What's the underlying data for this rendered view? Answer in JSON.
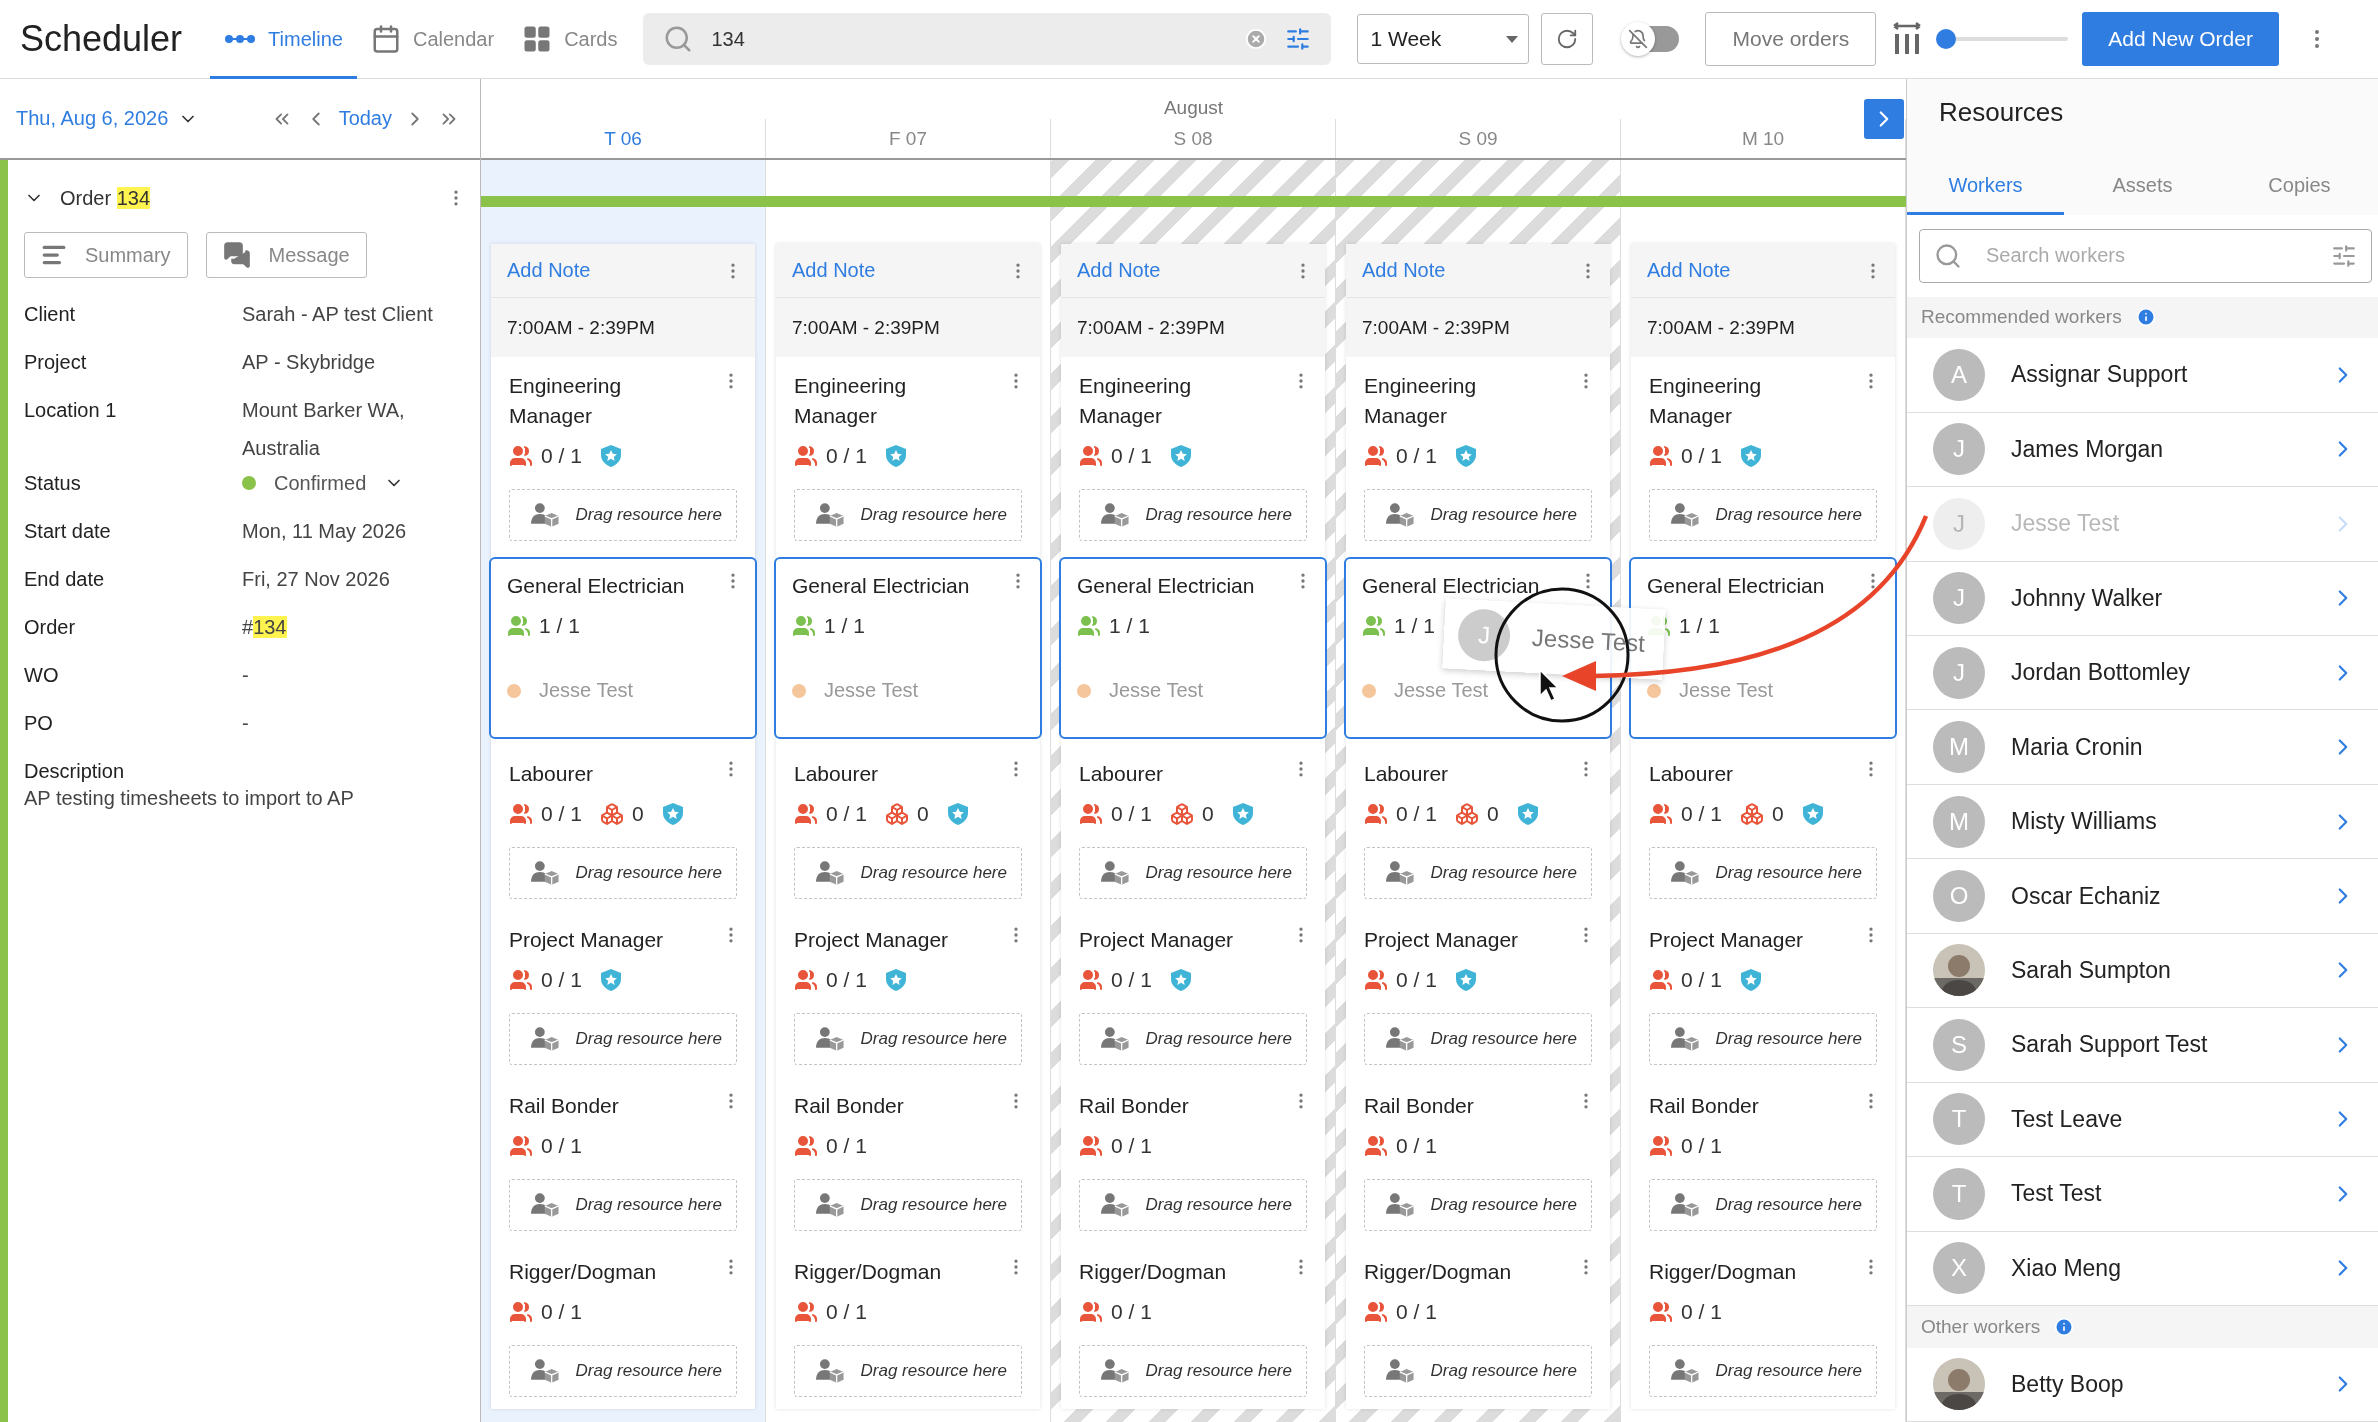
{
  "app": {
    "title": "Scheduler"
  },
  "views": [
    {
      "label": "Timeline",
      "kind": "timeline",
      "selected": true
    },
    {
      "label": "Calendar",
      "kind": "calendar",
      "selected": false
    },
    {
      "label": "Cards",
      "kind": "cards",
      "selected": false
    }
  ],
  "search": {
    "value": "134"
  },
  "range": {
    "value": "1 Week"
  },
  "notifications_toggle": {
    "on": false
  },
  "move_orders": "Move orders",
  "zoom_slider": {
    "level": 0
  },
  "add_button": "Add New Order",
  "date_nav": {
    "date": "Thu, Aug 6, 2026",
    "today": "Today"
  },
  "order": {
    "label": "Order",
    "match": "134",
    "expanded": true,
    "buttons": [
      {
        "label": "Summary",
        "kind": "summary"
      },
      {
        "label": "Message",
        "kind": "message"
      }
    ],
    "fields": [
      {
        "label": "Client",
        "kind": "text",
        "value": "Sarah - AP test Client"
      },
      {
        "label": "Project",
        "kind": "text",
        "value": "AP - Skybridge"
      },
      {
        "label": "Location 1",
        "kind": "text",
        "value": "Mount Barker WA, Australia"
      },
      {
        "label": "Status",
        "kind": "status",
        "value": "Confirmed",
        "color": "#8bc34a"
      },
      {
        "label": "Start date",
        "kind": "text",
        "value": "Mon, 11 May 2026"
      },
      {
        "label": "End date",
        "kind": "text",
        "value": "Fri, 27 Nov 2026"
      },
      {
        "label": "Order",
        "kind": "match",
        "prefix": "#",
        "value": "134"
      },
      {
        "label": "WO",
        "kind": "text",
        "value": "-"
      },
      {
        "label": "PO",
        "kind": "text",
        "value": "-"
      }
    ],
    "description": {
      "label": "Description",
      "text": "AP testing timesheets to import to AP"
    }
  },
  "timeline": {
    "month": "August",
    "days": [
      {
        "label": "T 06",
        "today": true,
        "weekend": false,
        "note_action": "Add Note",
        "shift": "7:00AM - 2:39PM",
        "roles": [
          {
            "title": "Engineering Manager",
            "count": "0 / 1",
            "full": false,
            "shield": true,
            "selected": false,
            "drop_hint": "Drag resource here"
          },
          {
            "title": "General Electrician",
            "count": "1 / 1",
            "full": true,
            "shield": false,
            "selected": true,
            "assigned": [
              {
                "name": "Jesse Test",
                "color": "#f5c59b"
              }
            ]
          },
          {
            "title": "Labourer",
            "count": "0 / 1",
            "full": false,
            "assets": "0",
            "shield": true,
            "selected": false,
            "drop_hint": "Drag resource here"
          },
          {
            "title": "Project Manager",
            "count": "0 / 1",
            "full": false,
            "shield": true,
            "selected": false,
            "drop_hint": "Drag resource here"
          },
          {
            "title": "Rail Bonder",
            "count": "0 / 1",
            "full": false,
            "shield": false,
            "selected": false,
            "drop_hint": "Drag resource here"
          },
          {
            "title": "Rigger/Dogman",
            "count": "0 / 1",
            "full": false,
            "shield": false,
            "selected": false,
            "drop_hint": "Drag resource here"
          }
        ]
      },
      {
        "label": "F 07",
        "today": false,
        "weekend": false,
        "note_action": "Add Note",
        "shift": "7:00AM - 2:39PM",
        "roles": [
          {
            "title": "Engineering Manager",
            "count": "0 / 1",
            "full": false,
            "shield": true,
            "selected": false,
            "drop_hint": "Drag resource here"
          },
          {
            "title": "General Electrician",
            "count": "1 / 1",
            "full": true,
            "shield": false,
            "selected": true,
            "assigned": [
              {
                "name": "Jesse Test",
                "color": "#f5c59b"
              }
            ]
          },
          {
            "title": "Labourer",
            "count": "0 / 1",
            "full": false,
            "assets": "0",
            "shield": true,
            "selected": false,
            "drop_hint": "Drag resource here"
          },
          {
            "title": "Project Manager",
            "count": "0 / 1",
            "full": false,
            "shield": true,
            "selected": false,
            "drop_hint": "Drag resource here"
          },
          {
            "title": "Rail Bonder",
            "count": "0 / 1",
            "full": false,
            "shield": false,
            "selected": false,
            "drop_hint": "Drag resource here"
          },
          {
            "title": "Rigger/Dogman",
            "count": "0 / 1",
            "full": false,
            "shield": false,
            "selected": false,
            "drop_hint": "Drag resource here"
          }
        ]
      },
      {
        "label": "S 08",
        "today": false,
        "weekend": true,
        "note_action": "Add Note",
        "shift": "7:00AM - 2:39PM",
        "roles": [
          {
            "title": "Engineering Manager",
            "count": "0 / 1",
            "full": false,
            "shield": true,
            "selected": false,
            "drop_hint": "Drag resource here"
          },
          {
            "title": "General Electrician",
            "count": "1 / 1",
            "full": true,
            "shield": false,
            "selected": true,
            "assigned": [
              {
                "name": "Jesse Test",
                "color": "#f5c59b"
              }
            ]
          },
          {
            "title": "Labourer",
            "count": "0 / 1",
            "full": false,
            "assets": "0",
            "shield": true,
            "selected": false,
            "drop_hint": "Drag resource here"
          },
          {
            "title": "Project Manager",
            "count": "0 / 1",
            "full": false,
            "shield": true,
            "selected": false,
            "drop_hint": "Drag resource here"
          },
          {
            "title": "Rail Bonder",
            "count": "0 / 1",
            "full": false,
            "shield": false,
            "selected": false,
            "drop_hint": "Drag resource here"
          },
          {
            "title": "Rigger/Dogman",
            "count": "0 / 1",
            "full": false,
            "shield": false,
            "selected": false,
            "drop_hint": "Drag resource here"
          }
        ]
      },
      {
        "label": "S 09",
        "today": false,
        "weekend": true,
        "note_action": "Add Note",
        "shift": "7:00AM - 2:39PM",
        "roles": [
          {
            "title": "Engineering Manager",
            "count": "0 / 1",
            "full": false,
            "shield": true,
            "selected": false,
            "drop_hint": "Drag resource here"
          },
          {
            "title": "General Electrician",
            "count": "1 / 1",
            "full": true,
            "shield": false,
            "selected": true,
            "assigned": [
              {
                "name": "Jesse Test",
                "color": "#f5c59b"
              }
            ]
          },
          {
            "title": "Labourer",
            "count": "0 / 1",
            "full": false,
            "assets": "0",
            "shield": true,
            "selected": false,
            "drop_hint": "Drag resource here"
          },
          {
            "title": "Project Manager",
            "count": "0 / 1",
            "full": false,
            "shield": true,
            "selected": false,
            "drop_hint": "Drag resource here"
          },
          {
            "title": "Rail Bonder",
            "count": "0 / 1",
            "full": false,
            "shield": false,
            "selected": false,
            "drop_hint": "Drag resource here"
          },
          {
            "title": "Rigger/Dogman",
            "count": "0 / 1",
            "full": false,
            "shield": false,
            "selected": false,
            "drop_hint": "Drag resource here"
          }
        ]
      },
      {
        "label": "M 10",
        "today": false,
        "weekend": false,
        "note_action": "Add Note",
        "shift": "7:00AM - 2:39PM",
        "roles": [
          {
            "title": "Engineering Manager",
            "count": "0 / 1",
            "full": false,
            "shield": true,
            "selected": false,
            "drop_hint": "Drag resource here"
          },
          {
            "title": "General Electrician",
            "count": "1 / 1",
            "full": true,
            "shield": false,
            "selected": true,
            "assigned": [
              {
                "name": "Jesse Test",
                "color": "#f5c59b"
              }
            ]
          },
          {
            "title": "Labourer",
            "count": "0 / 1",
            "full": false,
            "assets": "0",
            "shield": true,
            "selected": false,
            "drop_hint": "Drag resource here"
          },
          {
            "title": "Project Manager",
            "count": "0 / 1",
            "full": false,
            "shield": true,
            "selected": false,
            "drop_hint": "Drag resource here"
          },
          {
            "title": "Rail Bonder",
            "count": "0 / 1",
            "full": false,
            "shield": false,
            "selected": false,
            "drop_hint": "Drag resource here"
          },
          {
            "title": "Rigger/Dogman",
            "count": "0 / 1",
            "full": false,
            "shield": false,
            "selected": false,
            "drop_hint": "Drag resource here"
          }
        ]
      }
    ]
  },
  "drag_preview": {
    "initial": "J",
    "name": "Jesse Test"
  },
  "resources": {
    "title": "Resources",
    "tabs": [
      {
        "label": "Workers",
        "selected": true
      },
      {
        "label": "Assets",
        "selected": false
      },
      {
        "label": "Copies",
        "selected": false
      }
    ],
    "search": {
      "placeholder": "Search workers"
    },
    "groups": [
      {
        "title": "Recommended workers",
        "workers": [
          {
            "name": "Assignar Support",
            "kind": "initial",
            "initial": "A",
            "disabled": false
          },
          {
            "name": "James Morgan",
            "kind": "initial",
            "initial": "J",
            "disabled": false
          },
          {
            "name": "Jesse Test",
            "kind": "initial",
            "initial": "J",
            "disabled": true
          },
          {
            "name": "Johnny Walker",
            "kind": "initial",
            "initial": "J",
            "disabled": false
          },
          {
            "name": "Jordan Bottomley",
            "kind": "initial",
            "initial": "J",
            "disabled": false
          },
          {
            "name": "Maria Cronin",
            "kind": "initial",
            "initial": "M",
            "disabled": false
          },
          {
            "name": "Misty Williams",
            "kind": "initial",
            "initial": "M",
            "disabled": false
          },
          {
            "name": "Oscar Echaniz",
            "kind": "initial",
            "initial": "O",
            "disabled": false
          },
          {
            "name": "Sarah Sumpton",
            "disabled": false
          },
          {
            "name": "Sarah Support Test",
            "kind": "initial",
            "initial": "S",
            "disabled": false
          },
          {
            "name": "Test Leave",
            "kind": "initial",
            "initial": "T",
            "disabled": false
          },
          {
            "name": "Test Test",
            "kind": "initial",
            "initial": "T",
            "disabled": false
          },
          {
            "name": "Xiao Meng",
            "kind": "initial",
            "initial": "X",
            "disabled": false
          }
        ]
      },
      {
        "title": "Other workers",
        "workers": [
          {
            "name": "Betty Boop",
            "disabled": false
          }
        ]
      }
    ]
  }
}
